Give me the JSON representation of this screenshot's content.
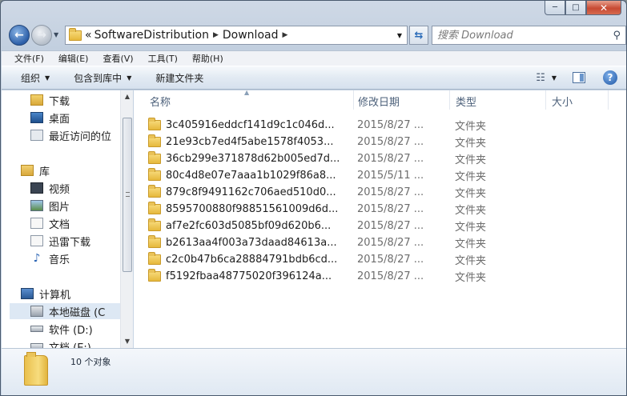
{
  "window": {
    "minimize_glyph": "─",
    "maximize_glyph": "□",
    "close_glyph": "✕"
  },
  "address": {
    "overflow": "«",
    "crumbs": [
      "SoftwareDistribution",
      "Download"
    ]
  },
  "search": {
    "placeholder": "搜索 Download"
  },
  "menu": [
    "文件(F)",
    "编辑(E)",
    "查看(V)",
    "工具(T)",
    "帮助(H)"
  ],
  "toolbar": {
    "organize": "组织",
    "include_library": "包含到库中",
    "new_folder": "新建文件夹"
  },
  "navpane": {
    "items": [
      {
        "label": "下载",
        "icon": "download-icon"
      },
      {
        "label": "桌面",
        "icon": "desktop-icon"
      },
      {
        "label": "最近访问的位",
        "icon": "recent-icon"
      },
      {
        "label": "库",
        "icon": "library-icon"
      },
      {
        "label": "视频",
        "icon": "video-icon"
      },
      {
        "label": "图片",
        "icon": "picture-icon"
      },
      {
        "label": "文档",
        "icon": "document-icon"
      },
      {
        "label": "迅雷下载",
        "icon": "document-icon"
      },
      {
        "label": "音乐",
        "icon": "music-icon"
      },
      {
        "label": "计算机",
        "icon": "computer-icon"
      },
      {
        "label": "本地磁盘 (C",
        "icon": "drive-icon"
      },
      {
        "label": "软件 (D:)",
        "icon": "drive-icon"
      },
      {
        "label": "文档 (E:)",
        "icon": "drive-icon"
      }
    ]
  },
  "columns": {
    "name": "名称",
    "date": "修改日期",
    "type": "类型",
    "size": "大小"
  },
  "files": [
    {
      "name": "3c405916eddcf141d9c1c046d...",
      "date": "2015/8/27 ...",
      "type": "文件夹"
    },
    {
      "name": "21e93cb7ed4f5abe1578f4053...",
      "date": "2015/8/27 ...",
      "type": "文件夹"
    },
    {
      "name": "36cb299e371878d62b005ed7d...",
      "date": "2015/8/27 ...",
      "type": "文件夹"
    },
    {
      "name": "80c4d8e07e7aaa1b1029f86a8...",
      "date": "2015/5/11 ...",
      "type": "文件夹"
    },
    {
      "name": "879c8f9491162c706aed510d0...",
      "date": "2015/8/27 ...",
      "type": "文件夹"
    },
    {
      "name": "8595700880f98851561009d6d...",
      "date": "2015/8/27 ...",
      "type": "文件夹"
    },
    {
      "name": "af7e2fc603d5085bf09d620b6...",
      "date": "2015/8/27 ...",
      "type": "文件夹"
    },
    {
      "name": "b2613aa4f003a73daad84613a...",
      "date": "2015/8/27 ...",
      "type": "文件夹"
    },
    {
      "name": "c2c0b47b6ca28884791bdb6cd...",
      "date": "2015/8/27 ...",
      "type": "文件夹"
    },
    {
      "name": "f5192fbaa48775020f396124a...",
      "date": "2015/8/27 ...",
      "type": "文件夹"
    }
  ],
  "status": {
    "count": "10 个对象"
  }
}
